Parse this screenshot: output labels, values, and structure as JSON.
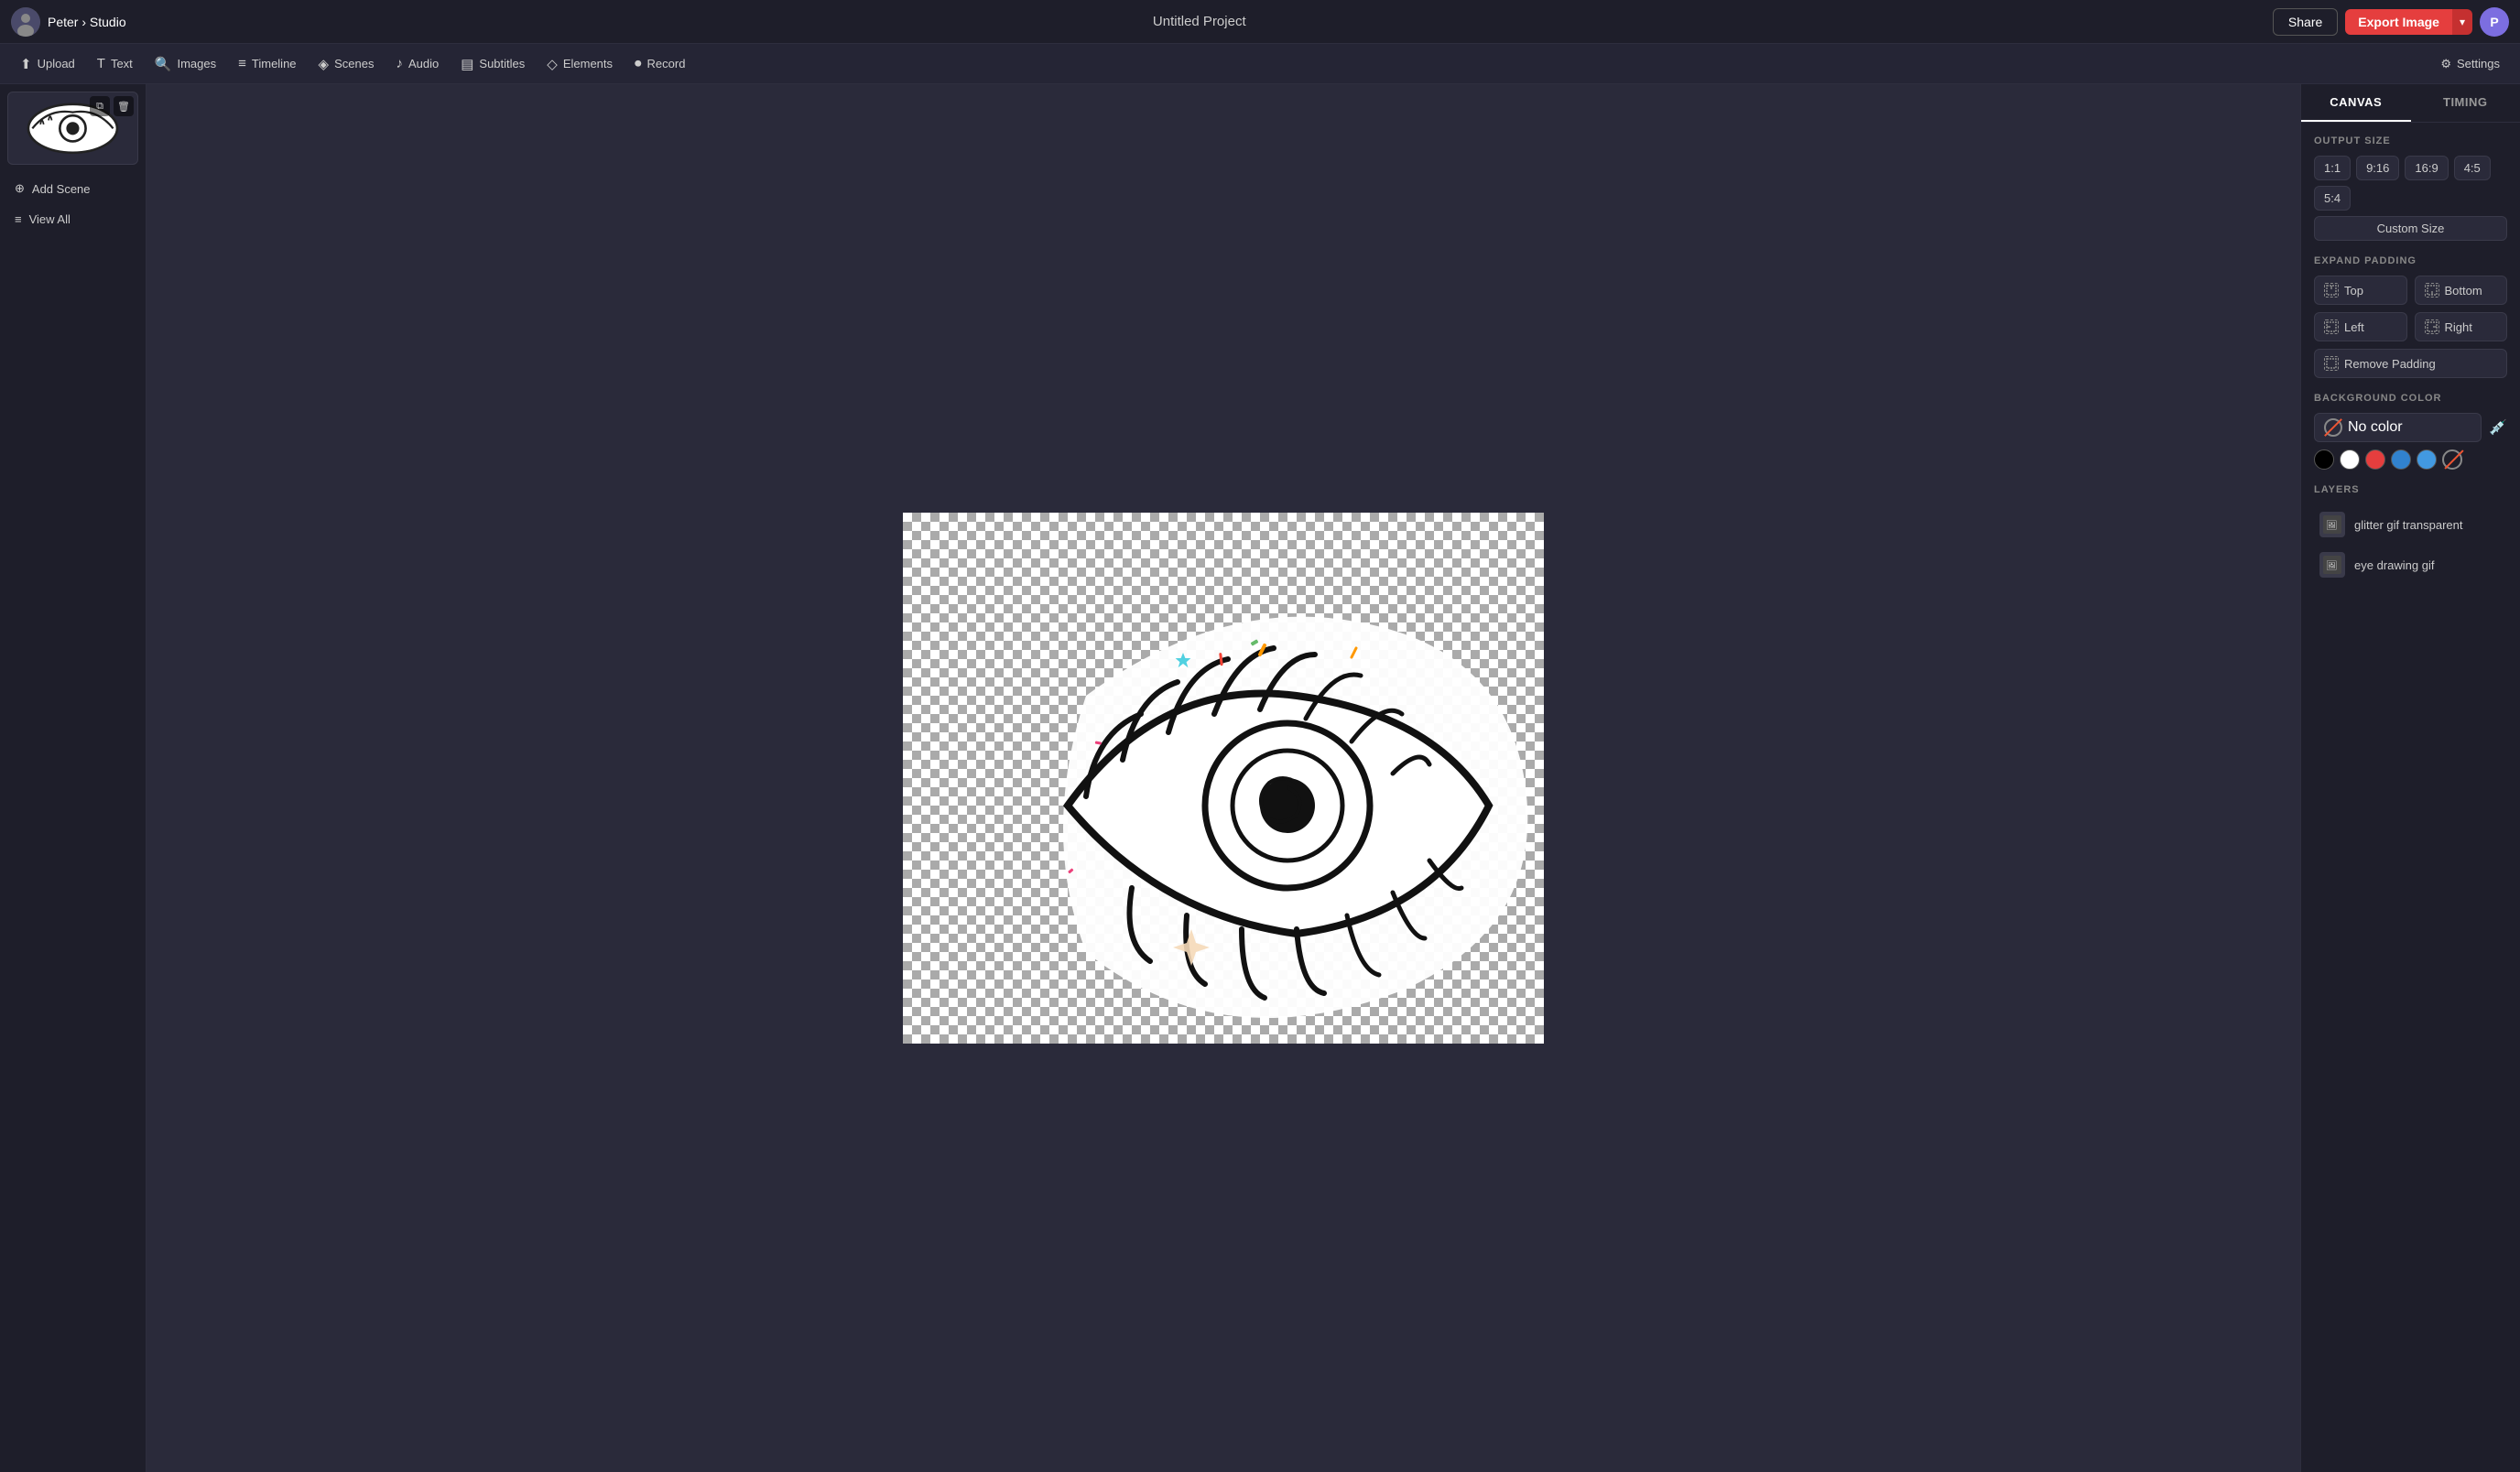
{
  "app": {
    "user_name": "Peter",
    "breadcrumb_separator": "›",
    "parent": "Studio",
    "project_title": "Untitled Project",
    "user_initial": "P"
  },
  "header": {
    "share_label": "Share",
    "export_label": "Export Image"
  },
  "toolbar": {
    "items": [
      {
        "id": "upload",
        "icon": "⬆",
        "label": "Upload"
      },
      {
        "id": "text",
        "icon": "T",
        "label": "Text"
      },
      {
        "id": "images",
        "icon": "🔍",
        "label": "Images"
      },
      {
        "id": "timeline",
        "icon": "≡",
        "label": "Timeline"
      },
      {
        "id": "scenes",
        "icon": "◈",
        "label": "Scenes"
      },
      {
        "id": "audio",
        "icon": "♪",
        "label": "Audio"
      },
      {
        "id": "subtitles",
        "icon": "▤",
        "label": "Subtitles"
      },
      {
        "id": "elements",
        "icon": "◇",
        "label": "Elements"
      },
      {
        "id": "record",
        "icon": "⏺",
        "label": "Record"
      }
    ],
    "settings_label": "Settings"
  },
  "sidebar": {
    "add_scene_label": "Add Scene",
    "view_all_label": "View All"
  },
  "right_panel": {
    "tabs": [
      {
        "id": "canvas",
        "label": "CANVAS",
        "active": true
      },
      {
        "id": "timing",
        "label": "TIMING",
        "active": false
      }
    ],
    "output_size": {
      "label": "OUTPUT SIZE",
      "options": [
        "1:1",
        "9:16",
        "16:9",
        "4:5",
        "5:4"
      ],
      "custom_label": "Custom Size"
    },
    "expand_padding": {
      "label": "EXPAND PADDING",
      "buttons": [
        "Top",
        "Bottom",
        "Left",
        "Right"
      ],
      "remove_label": "Remove Padding"
    },
    "background_color": {
      "label": "BACKGROUND COLOR",
      "no_color_label": "No color",
      "swatches": [
        "black",
        "white",
        "red",
        "blue",
        "blue2",
        "none"
      ]
    },
    "layers": {
      "label": "LAYERS",
      "items": [
        {
          "id": "layer1",
          "name": "glitter gif transparent",
          "icon": "🖼"
        },
        {
          "id": "layer2",
          "name": "eye drawing gif",
          "icon": "🖼"
        }
      ]
    }
  }
}
